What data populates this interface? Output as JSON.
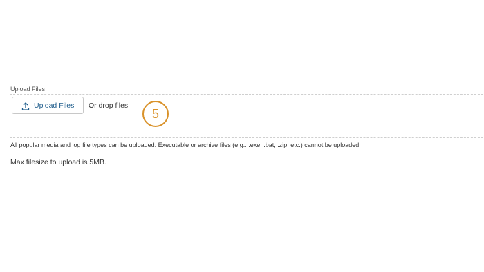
{
  "upload": {
    "section_label": "Upload Files",
    "button_label": "Upload Files",
    "drop_text": "Or drop files",
    "help_text": "All popular media and log file types can be uploaded. Executable or archive files (e.g.: .exe, .bat, .zip, etc.) cannot be uploaded.",
    "size_text": "Max filesize to upload is 5MB."
  },
  "annotation": {
    "step_number": "5",
    "color": "#d9922a"
  },
  "colors": {
    "button_text": "#1f5d8c",
    "dropzone_border": "#cfcfcf"
  },
  "icons": {
    "upload_button_icon": "upload-icon"
  }
}
